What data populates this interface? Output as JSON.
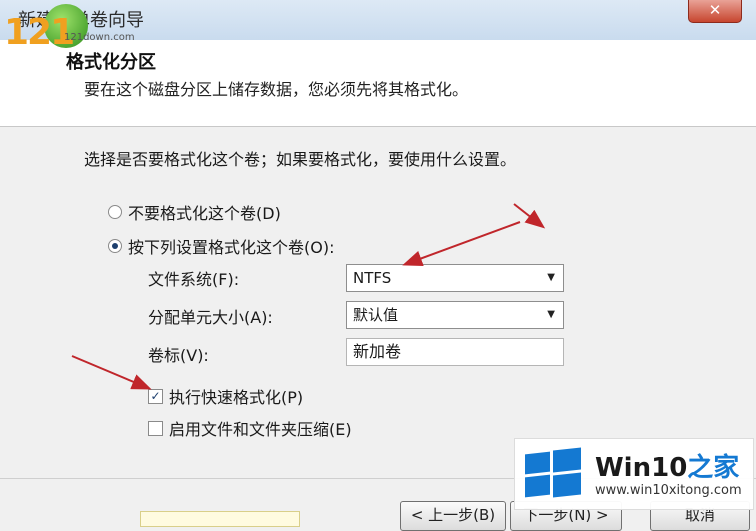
{
  "window": {
    "title": "新建简单卷向导",
    "close_glyph": "✕"
  },
  "header": {
    "title": "格式化分区",
    "description": "要在这个磁盘分区上储存数据，您必须先将其格式化。"
  },
  "logo_overlay": {
    "number": "121",
    "site": "121down.com"
  },
  "main": {
    "question": "选择是否要格式化这个卷；如果要格式化，要使用什么设置。",
    "option_no_format": "不要格式化这个卷(D)",
    "option_format": "按下列设置格式化这个卷(O):",
    "selected_option": "format",
    "file_system_label": "文件系统(F):",
    "file_system_value": "NTFS",
    "allocation_label": "分配单元大小(A):",
    "allocation_value": "默认值",
    "volume_label_label": "卷标(V):",
    "volume_label_value": "新加卷",
    "quick_format_label": "执行快速格式化(P)",
    "quick_format_checked": true,
    "compression_label": "启用文件和文件夹压缩(E)",
    "compression_checked": false
  },
  "footer": {
    "back_button": "< 上一步(B)",
    "next_button": "下一步(N) >",
    "cancel_button": "取消"
  },
  "watermark": {
    "title_main": "Win10",
    "title_cn": "之家",
    "url": "www.win10xitong.com"
  },
  "colors": {
    "accent_blue": "#1479d2",
    "arrow_red": "#c0262b",
    "logo_orange": "#f0a020",
    "logo_green": "#2f8f1c"
  }
}
